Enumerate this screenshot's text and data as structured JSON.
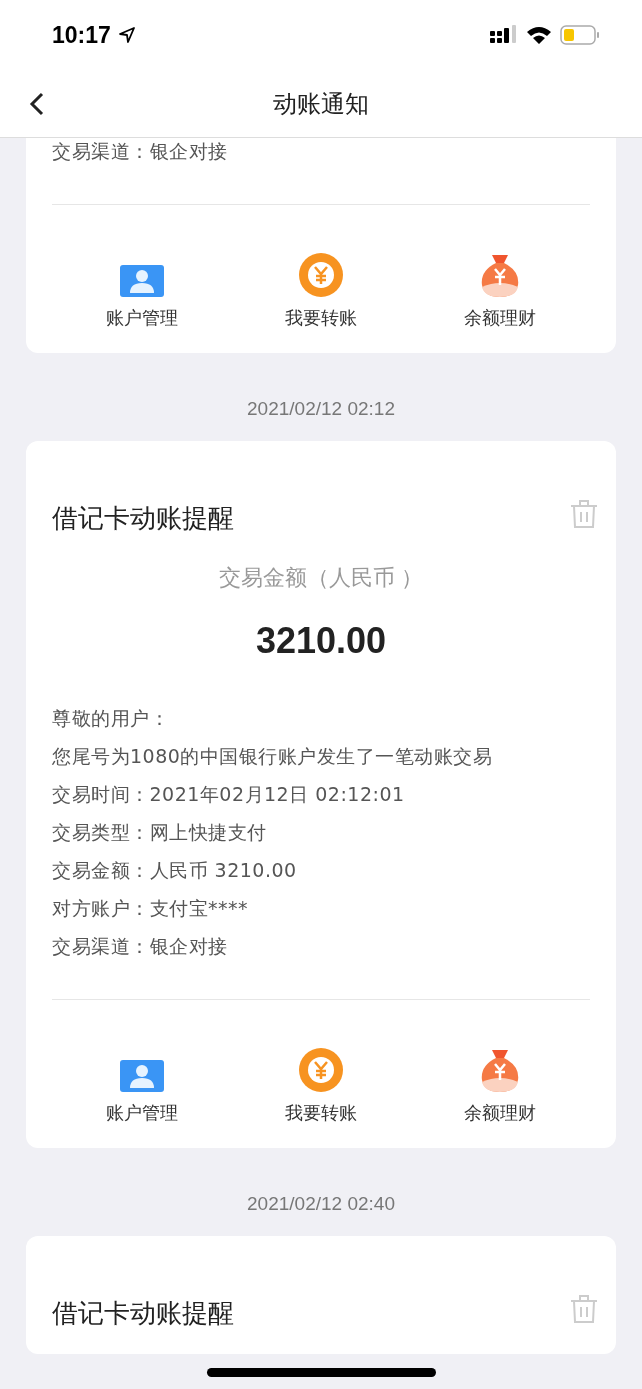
{
  "status_bar": {
    "time": "10:17"
  },
  "nav": {
    "title": "动账通知"
  },
  "notices": [
    {
      "lines": [
        "交易渠道：银企对接"
      ],
      "actions": [
        {
          "kind": "account",
          "label": "账户管理"
        },
        {
          "kind": "transfer",
          "label": "我要转账"
        },
        {
          "kind": "wealth",
          "label": "余额理财"
        }
      ]
    },
    {
      "date": "2021/02/12 02:12",
      "title": "借记卡动账提醒",
      "amount_label": "交易金额（人民币 ）",
      "amount": "3210.00",
      "lines": [
        "尊敬的用户：",
        "您尾号为1080的中国银行账户发生了一笔动账交易",
        "交易时间：2021年02月12日 02:12:01",
        "交易类型：网上快捷支付",
        "交易金额：人民币 3210.00",
        "对方账户：支付宝****",
        "交易渠道：银企对接"
      ],
      "actions": [
        {
          "kind": "account",
          "label": "账户管理"
        },
        {
          "kind": "transfer",
          "label": "我要转账"
        },
        {
          "kind": "wealth",
          "label": "余额理财"
        }
      ]
    },
    {
      "date": "2021/02/12 02:40",
      "title": "借记卡动账提醒"
    }
  ]
}
